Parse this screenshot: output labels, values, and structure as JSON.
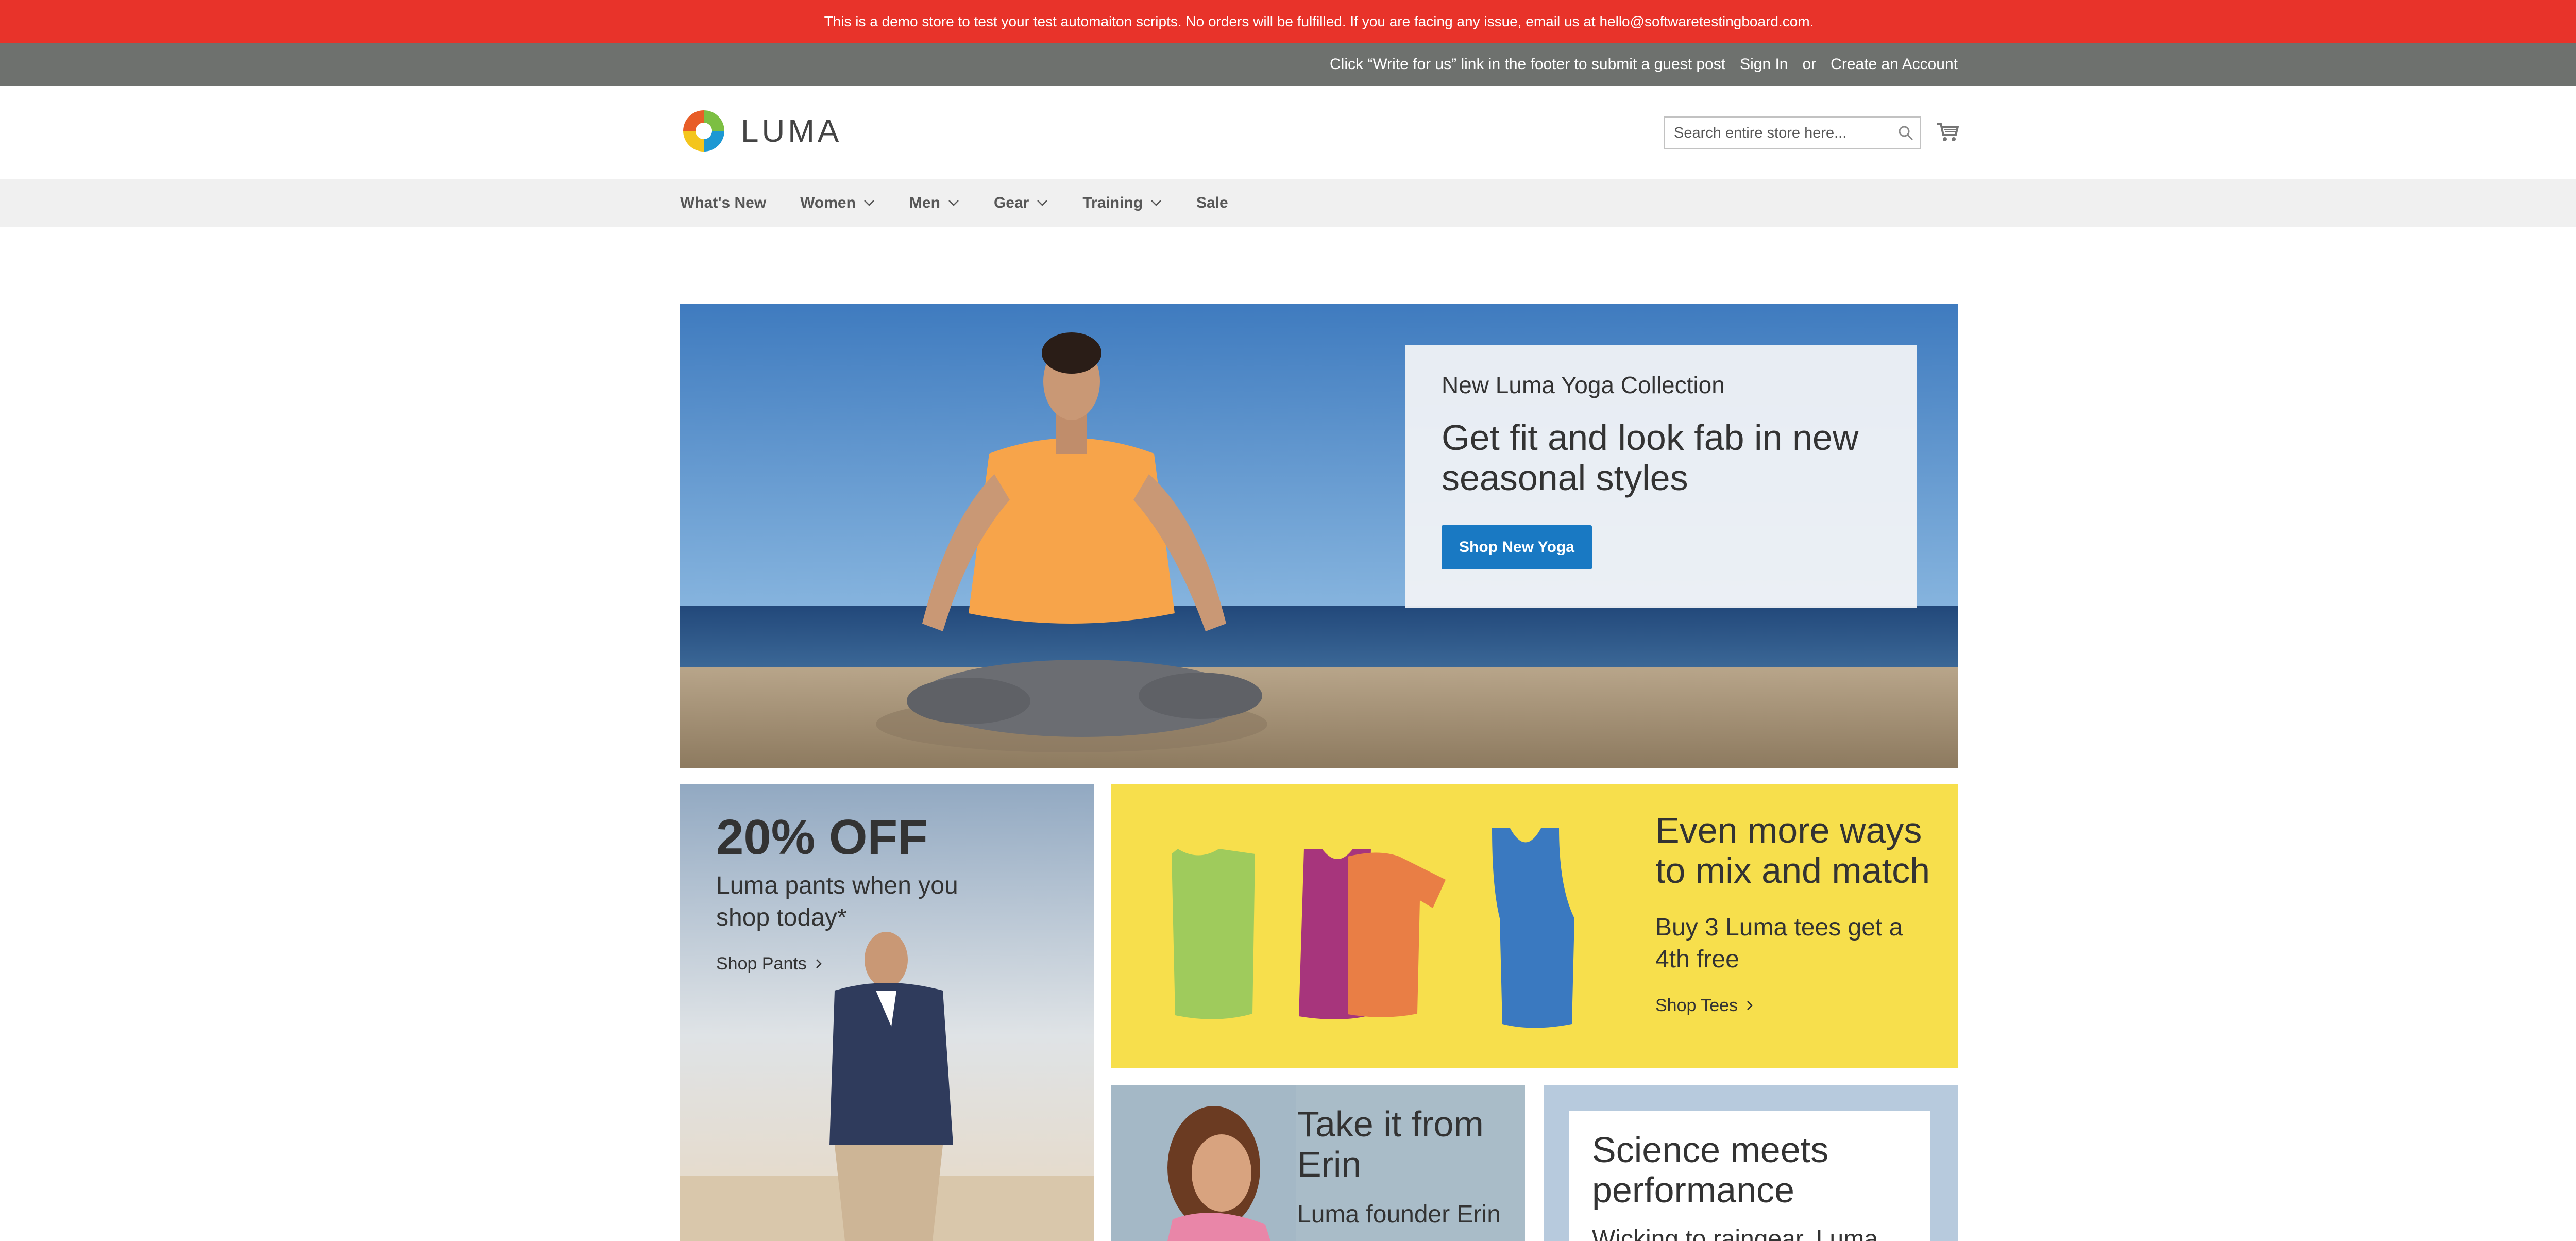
{
  "notice": {
    "text": "This is a demo store to test your test automaiton scripts. No orders will be fulfilled. If you are facing any issue, email us at hello@softwaretestingboard.com."
  },
  "topbar": {
    "guest_post": "Click “Write for us” link in the footer to submit a guest post",
    "sign_in": "Sign In",
    "or": "or",
    "create_account": "Create an Account"
  },
  "header": {
    "logo_text": "LUMA",
    "search_placeholder": "Search entire store here...",
    "search_icon": "search-icon",
    "cart_icon": "cart-icon"
  },
  "nav": {
    "items": [
      {
        "label": "What's New",
        "dropdown": false
      },
      {
        "label": "Women",
        "dropdown": true
      },
      {
        "label": "Men",
        "dropdown": true
      },
      {
        "label": "Gear",
        "dropdown": true
      },
      {
        "label": "Training",
        "dropdown": true
      },
      {
        "label": "Sale",
        "dropdown": false
      }
    ]
  },
  "hero": {
    "kicker": "New Luma Yoga Collection",
    "title": "Get fit and look fab in new seasonal styles",
    "button": "Shop New Yoga"
  },
  "promo_pants": {
    "headline": "20% OFF",
    "subtitle": "Luma pants when you shop today*",
    "link": "Shop Pants"
  },
  "promo_tees": {
    "title": "Even more ways to mix and match",
    "subtitle": "Buy 3 Luma tees get a 4th free",
    "link": "Shop Tees"
  },
  "promo_erin": {
    "title": "Take it from Erin",
    "subtitle": "Luma founder Erin"
  },
  "promo_science": {
    "title": "Science meets performance",
    "subtitle": "Wicking to raingear, Luma"
  },
  "colors": {
    "notice_bg": "#e8332a",
    "topbar_bg": "#6e716e",
    "nav_bg": "#f0f0f0",
    "primary_button": "#1979c3",
    "tees_bg": "#f7df4c"
  }
}
